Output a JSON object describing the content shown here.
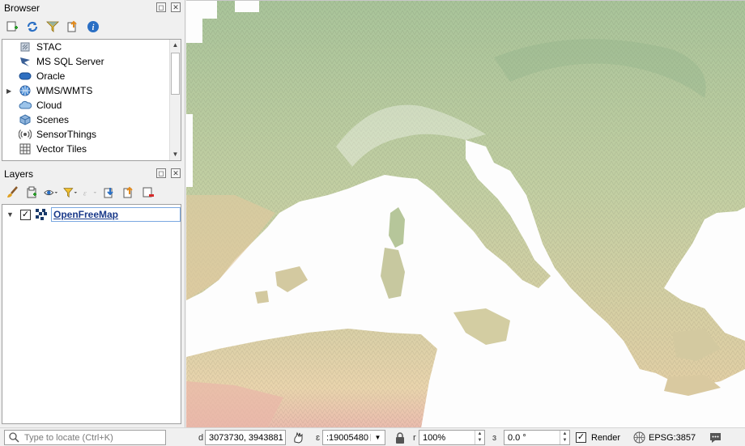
{
  "browser": {
    "title": "Browser",
    "items": [
      {
        "label": "STAC",
        "icon": "stac-icon"
      },
      {
        "label": "MS SQL Server",
        "icon": "mssql-icon"
      },
      {
        "label": "Oracle",
        "icon": "oracle-icon"
      },
      {
        "label": "WMS/WMTS",
        "icon": "wms-icon",
        "expandable": true
      },
      {
        "label": "Cloud",
        "icon": "cloud-icon"
      },
      {
        "label": "Scenes",
        "icon": "scenes-icon"
      },
      {
        "label": "SensorThings",
        "icon": "sensorthings-icon"
      },
      {
        "label": "Vector Tiles",
        "icon": "vector-tiles-icon"
      }
    ]
  },
  "layers": {
    "title": "Layers",
    "items": [
      {
        "label": "OpenFreeMap",
        "checked": true,
        "expanded": true
      }
    ]
  },
  "dock_buttons": {
    "float": "◻",
    "close": "✕"
  },
  "statusbar": {
    "locator_placeholder": "Type to locate (Ctrl+K)",
    "coord_label": "d",
    "coordinate": "3073730, 3943881",
    "scale_label": "ɛ",
    "scale": ":19005480",
    "magnifier_label": "r",
    "magnifier": "100%",
    "rotation_label": "ɜ",
    "rotation": "0.0 °",
    "render_label": "Render",
    "render_checked": true,
    "crs": "EPSG:3857"
  },
  "colors": {
    "panel_bg": "#f0f0f0",
    "map_sea": "#fdfdfd",
    "map_land_green": "#a9c49a",
    "map_land_sand": "#e6cfa8",
    "map_land_pink": "#e8b7a8"
  }
}
